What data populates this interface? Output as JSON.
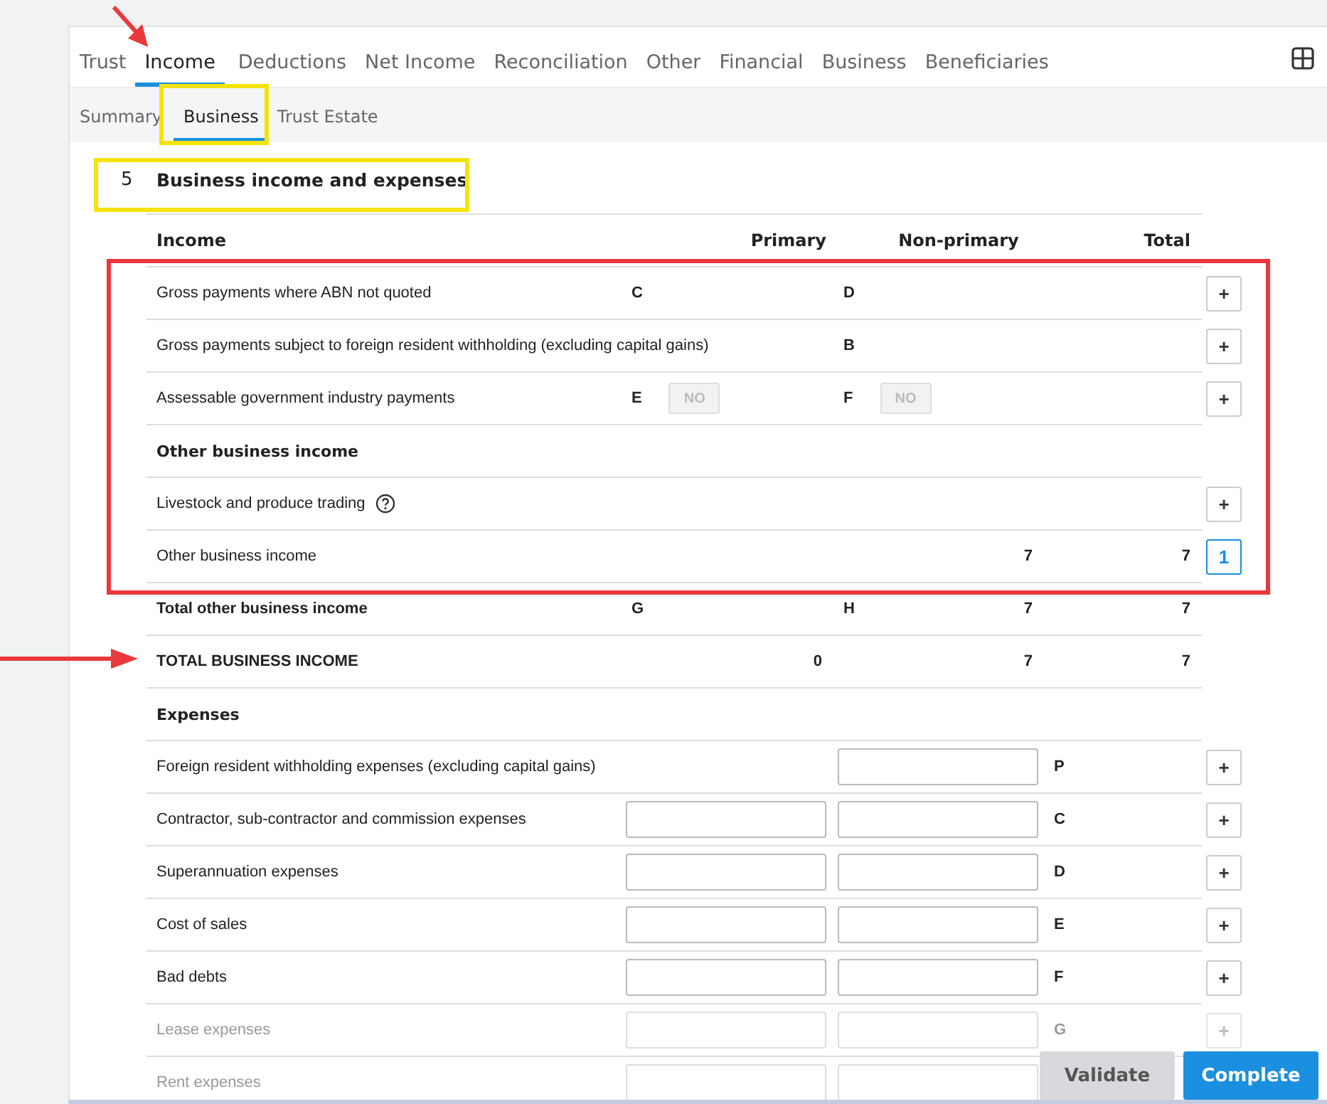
{
  "tabs": [
    {
      "label": "Trust",
      "selected": false
    },
    {
      "label": "Income",
      "selected": true
    },
    {
      "label": "Deductions",
      "selected": false
    },
    {
      "label": "Net Income",
      "selected": false
    },
    {
      "label": "Reconciliation",
      "selected": false
    },
    {
      "label": "Other",
      "selected": false
    },
    {
      "label": "Financial",
      "selected": false
    },
    {
      "label": "Business",
      "selected": false
    },
    {
      "label": "Beneficiaries",
      "selected": false
    }
  ],
  "subtabs": [
    {
      "label": "Summary",
      "selected": false
    },
    {
      "label": "Business",
      "selected": true
    },
    {
      "label": "Trust Estate",
      "selected": false
    }
  ],
  "section": {
    "number": "5",
    "title": "Business income and expenses"
  },
  "table": {
    "columns": [
      "Income",
      "Primary",
      "Non-primary",
      "Total"
    ],
    "rows": [
      {
        "kind": "item",
        "label": "Gross payments where ABN not quoted",
        "primary_code": "C",
        "nonprimary_code": "D",
        "action": {
          "label": "+",
          "active": false
        }
      },
      {
        "kind": "item",
        "label": "Gross payments subject to foreign resident withholding (excluding capital gains)",
        "nonprimary_code": "B",
        "action": {
          "label": "+",
          "active": false
        }
      },
      {
        "kind": "item",
        "label": "Assessable government industry payments",
        "primary_code": "E",
        "primary_toggle": "NO",
        "nonprimary_code": "F",
        "nonprimary_toggle": "NO",
        "action": {
          "label": "+",
          "active": false
        }
      },
      {
        "kind": "heading",
        "label": "Other business income"
      },
      {
        "kind": "item",
        "label": "Livestock and produce trading",
        "help": true,
        "action": {
          "label": "+",
          "active": false
        }
      },
      {
        "kind": "item",
        "label": "Other business income",
        "nonprimary_value": "7",
        "total": "7",
        "action": {
          "label": "1",
          "active": true
        }
      },
      {
        "kind": "total",
        "label": "Total other business income",
        "primary_code": "G",
        "nonprimary_code": "H",
        "nonprimary_value": "7",
        "total": "7"
      },
      {
        "kind": "total",
        "label": "TOTAL BUSINESS INCOME",
        "primary_value": "0",
        "nonprimary_value": "7",
        "total": "7"
      },
      {
        "kind": "heading",
        "label": "Expenses"
      },
      {
        "kind": "expense",
        "label": "Foreign resident withholding expenses (excluding capital gains)",
        "primary_input": false,
        "nonprimary_input": true,
        "code": "P",
        "action": {
          "label": "+",
          "active": false
        }
      },
      {
        "kind": "expense",
        "label": "Contractor, sub-contractor and commission expenses",
        "primary_input": true,
        "nonprimary_input": true,
        "code": "C",
        "action": {
          "label": "+",
          "active": false
        }
      },
      {
        "kind": "expense",
        "label": "Superannuation expenses",
        "primary_input": true,
        "nonprimary_input": true,
        "code": "D",
        "action": {
          "label": "+",
          "active": false
        }
      },
      {
        "kind": "expense",
        "label": "Cost of sales",
        "primary_input": true,
        "nonprimary_input": true,
        "code": "E",
        "action": {
          "label": "+",
          "active": false
        }
      },
      {
        "kind": "expense",
        "label": "Bad debts",
        "primary_input": true,
        "nonprimary_input": true,
        "code": "F",
        "action": {
          "label": "+",
          "active": false
        }
      },
      {
        "kind": "expense",
        "label": "Lease expenses",
        "primary_input": true,
        "nonprimary_input": true,
        "code": "G",
        "dimmed": true,
        "action": {
          "label": "+",
          "active": false
        }
      },
      {
        "kind": "expense",
        "label": "Rent expenses",
        "primary_input": true,
        "nonprimary_input": true,
        "dimmed": true
      }
    ]
  },
  "footer": {
    "buttons": [
      {
        "label": "Validate",
        "primary": false
      },
      {
        "label": "Complete",
        "primary": true
      }
    ]
  }
}
